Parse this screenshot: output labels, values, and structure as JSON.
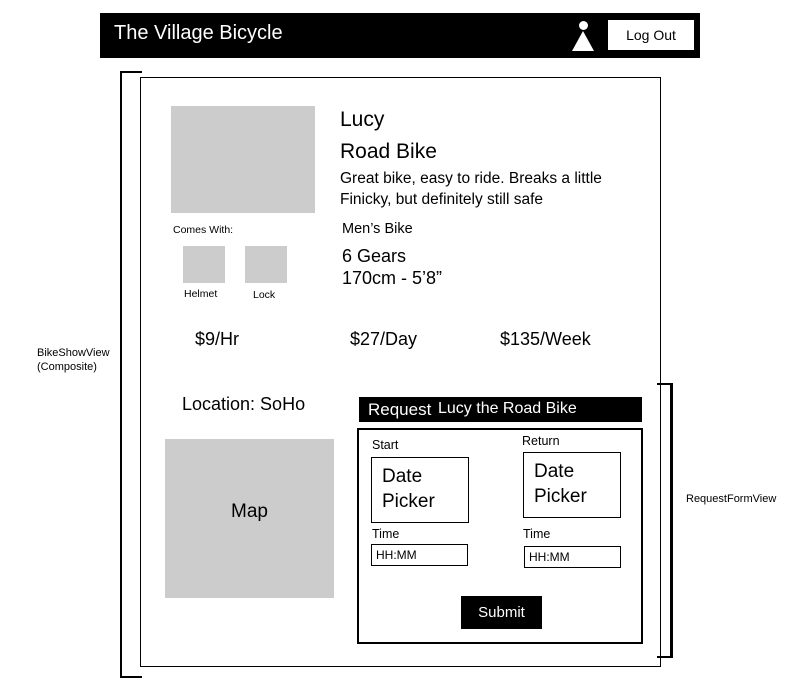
{
  "header": {
    "title": "The Village Bicycle",
    "user_icon": "user-icon",
    "logout_label": "Log Out"
  },
  "annotations": {
    "left": "BikeShowView\n(Composite)",
    "left_line1": "BikeShowView",
    "left_line2": "(Composite)",
    "right": "RequestFormView"
  },
  "bike": {
    "name": "Lucy",
    "type": "Road Bike",
    "description": "Great bike, easy to ride. Breaks a little Finicky, but definitely still safe",
    "gender": "Men’s Bike",
    "gears": "6 Gears",
    "size": "170cm - 5’8”"
  },
  "accessories": {
    "heading": "Comes With:",
    "items": [
      {
        "label": "Helmet"
      },
      {
        "label": "Lock"
      }
    ]
  },
  "prices": {
    "hourly": "$9/Hr",
    "daily": "$27/Day",
    "weekly": "$135/Week"
  },
  "location": {
    "label": "Location: SoHo",
    "map_label": "Map"
  },
  "request_form": {
    "heading_prefix": "Request",
    "heading_bike": "Lucy the Road Bike",
    "start_label": "Start",
    "return_label": "Return",
    "date_picker_line1": "Date",
    "date_picker_line2": "Picker",
    "time_label": "Time",
    "time_placeholder": "HH:MM",
    "submit_label": "Submit"
  }
}
